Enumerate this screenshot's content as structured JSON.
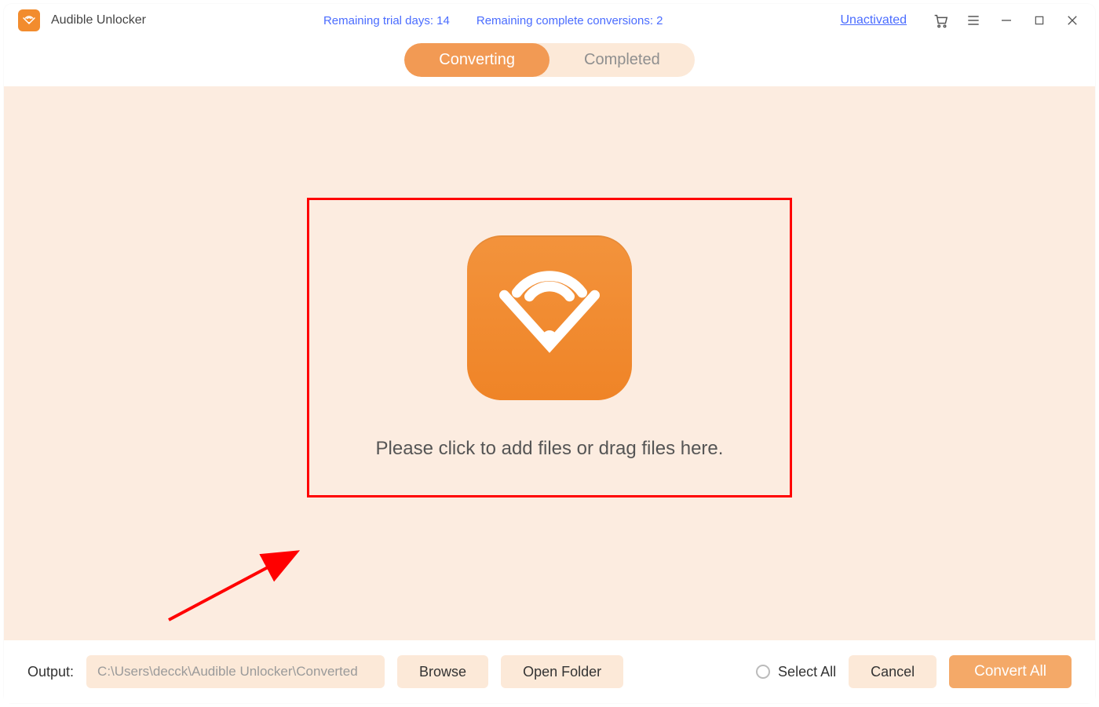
{
  "app": {
    "title": "Audible Unlocker",
    "trial_days_label": "Remaining trial days: 14",
    "conversions_label": "Remaining complete conversions: 2",
    "unactivated_label": "Unactivated"
  },
  "tabs": {
    "converting": "Converting",
    "completed": "Completed",
    "active": "converting"
  },
  "dropzone": {
    "text": "Please click to add files or drag files here."
  },
  "footer": {
    "output_label": "Output:",
    "output_path": "C:\\Users\\decck\\Audible Unlocker\\Converted",
    "browse": "Browse",
    "open_folder": "Open Folder",
    "select_all": "Select All",
    "cancel": "Cancel",
    "convert_all": "Convert All"
  },
  "colors": {
    "accent": "#f28c2e",
    "accent_light": "#fce9d8",
    "link": "#4a6cff",
    "annotation": "#ff0000"
  }
}
